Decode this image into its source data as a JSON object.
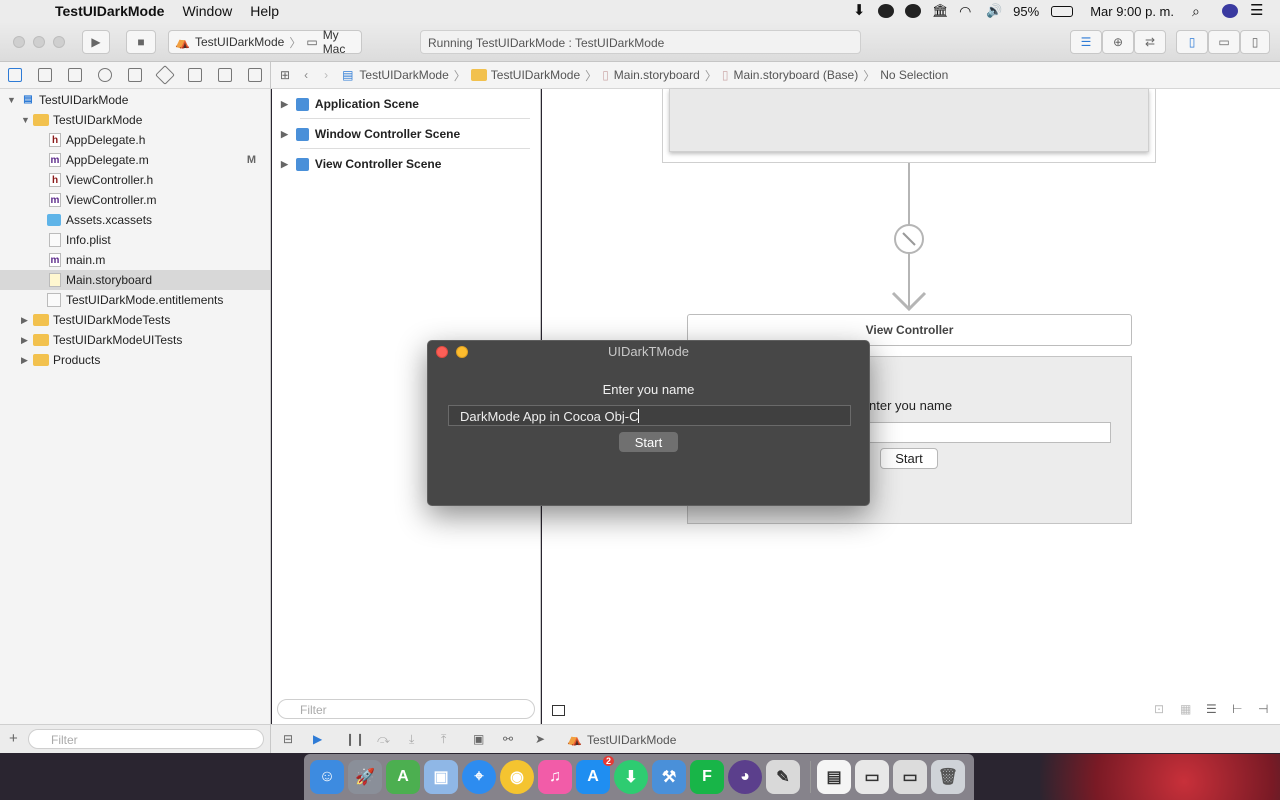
{
  "menubar": {
    "app_name": "TestUIDarkMode",
    "items": [
      "Window",
      "Help"
    ],
    "battery": "95%",
    "clock": "Mar 9:00 p. m."
  },
  "toolbar": {
    "scheme": "TestUIDarkMode",
    "destination": "My Mac",
    "activity": "Running TestUIDarkMode : TestUIDarkMode"
  },
  "jumpbar": {
    "crumbs": [
      "TestUIDarkMode",
      "TestUIDarkMode",
      "Main.storyboard",
      "Main.storyboard (Base)",
      "No Selection"
    ]
  },
  "navigator": {
    "items": [
      {
        "label": "TestUIDarkMode",
        "flag": ""
      },
      {
        "label": "TestUIDarkMode",
        "flag": ""
      },
      {
        "label": "AppDelegate.h",
        "flag": ""
      },
      {
        "label": "AppDelegate.m",
        "flag": "M"
      },
      {
        "label": "ViewController.h",
        "flag": ""
      },
      {
        "label": "ViewController.m",
        "flag": ""
      },
      {
        "label": "Assets.xcassets",
        "flag": ""
      },
      {
        "label": "Info.plist",
        "flag": ""
      },
      {
        "label": "main.m",
        "flag": ""
      },
      {
        "label": "Main.storyboard",
        "flag": ""
      },
      {
        "label": "TestUIDarkMode.entitlements",
        "flag": ""
      },
      {
        "label": "TestUIDarkModeTests",
        "flag": ""
      },
      {
        "label": "TestUIDarkModeUITests",
        "flag": ""
      },
      {
        "label": "Products",
        "flag": ""
      }
    ],
    "filter_placeholder": "Filter"
  },
  "outline": {
    "scenes": [
      "Application Scene",
      "Window Controller Scene",
      "View Controller Scene"
    ],
    "filter_placeholder": "Filter"
  },
  "canvas": {
    "vc_title": "View Controller",
    "vc_label": "nter you name",
    "vc_button": "Start"
  },
  "debugbar": {
    "target": "TestUIDarkMode"
  },
  "running_app": {
    "title": "UIDarkTMode",
    "label": "Enter you name",
    "field_value": "DarkMode App in Cocoa Obj-C",
    "button": "Start"
  },
  "dock": {
    "badge": "2"
  }
}
